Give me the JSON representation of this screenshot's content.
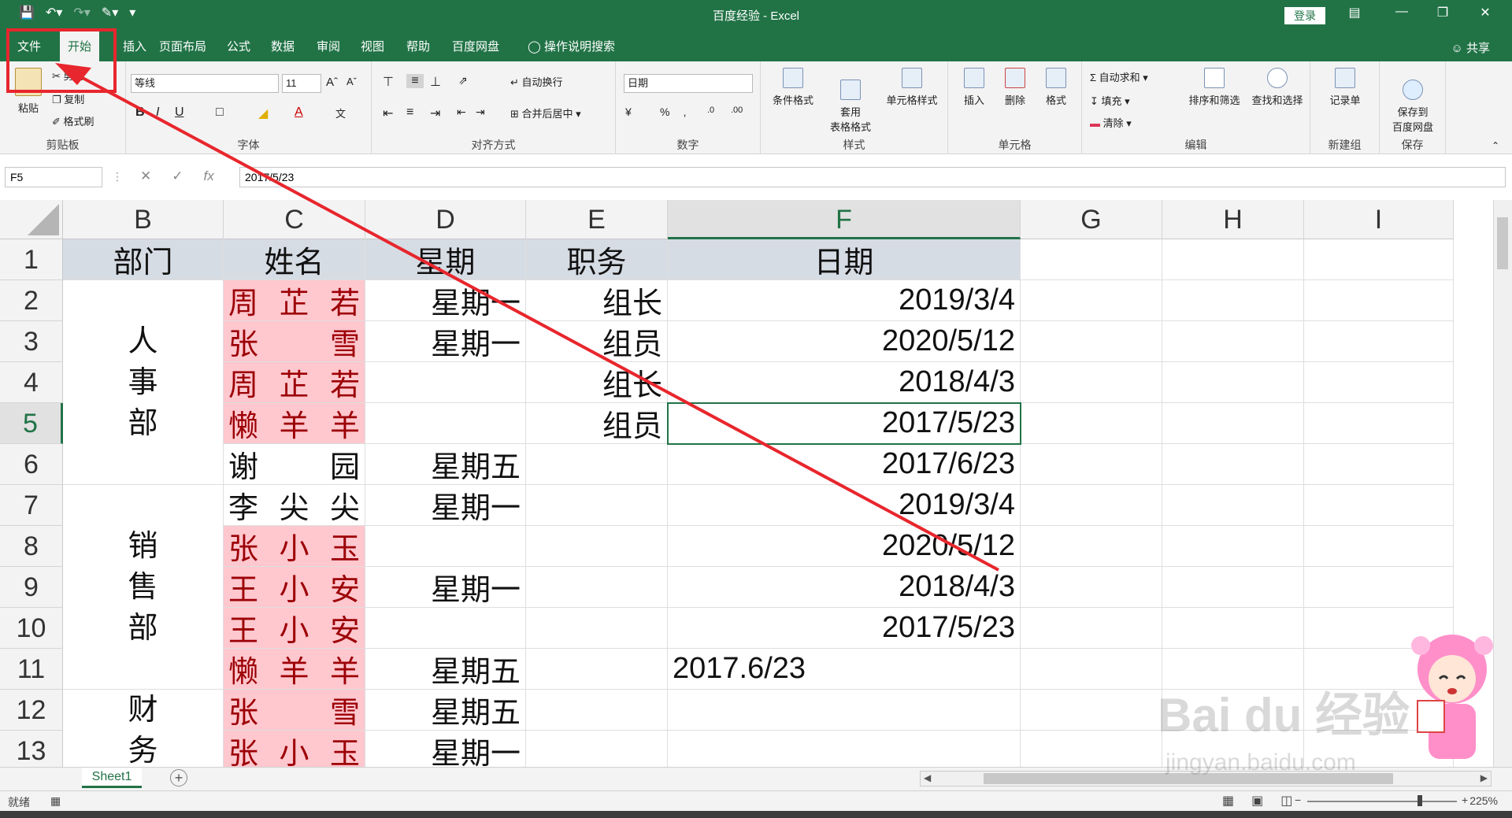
{
  "window": {
    "title": "百度经验 - Excel",
    "login_label": "登录",
    "share_label": "共享"
  },
  "ribbon_tabs": [
    "文件",
    "开始",
    "插入",
    "页面布局",
    "公式",
    "数据",
    "审阅",
    "视图",
    "帮助",
    "百度网盘",
    "操作说明搜索"
  ],
  "active_tab": "开始",
  "ribbon": {
    "clipboard": {
      "label": "剪贴板",
      "paste": "粘贴",
      "cut": "剪切",
      "copy": "复制",
      "format_painter": "格式刷"
    },
    "font": {
      "label": "字体",
      "font_name": "等线",
      "font_size": "11",
      "bold": "B",
      "italic": "I",
      "underline": "U"
    },
    "alignment": {
      "label": "对齐方式",
      "wrap_text": "自动换行",
      "merge_center": "合并后居中"
    },
    "number": {
      "label": "数字",
      "format": "日期",
      "percent": "%"
    },
    "styles": {
      "label": "样式",
      "conditional": "条件格式",
      "table_format": "套用\n表格格式",
      "cell_styles": "单元格样式"
    },
    "cells": {
      "label": "单元格",
      "insert": "插入",
      "delete": "删除",
      "format": "格式"
    },
    "editing": {
      "label": "编辑",
      "autosum": "自动求和",
      "fill": "填充",
      "clear": "清除",
      "sort_filter": "排序和筛选",
      "find_select": "查找和选择"
    },
    "new_group": {
      "label": "新建组",
      "record": "记录单"
    },
    "save": {
      "label": "保存",
      "save_to": "保存到\n百度网盘"
    }
  },
  "formula_bar": {
    "name_box": "F5",
    "value": "2017/5/23",
    "fx": "fx"
  },
  "columns": [
    "B",
    "C",
    "D",
    "E",
    "F",
    "G",
    "H",
    "I"
  ],
  "selected_column": "F",
  "rows": [
    "1",
    "2",
    "3",
    "4",
    "5",
    "6",
    "7",
    "8",
    "9",
    "10",
    "11",
    "12",
    "13"
  ],
  "selected_row": "5",
  "sheet": {
    "header": {
      "B": "部门",
      "C": "姓名",
      "D": "星期",
      "E": "职务",
      "F": "日期"
    },
    "dept_groups": [
      {
        "chars": [
          "人",
          "事",
          "部"
        ]
      },
      {
        "chars": [
          "销",
          "售",
          "部"
        ]
      },
      {
        "chars": [
          "财",
          "务"
        ]
      }
    ],
    "names": [
      [
        "周",
        "芷",
        "若"
      ],
      [
        "张",
        "",
        "雪"
      ],
      [
        "周",
        "芷",
        "若"
      ],
      [
        "懒",
        "羊",
        "羊"
      ],
      [
        "谢",
        "",
        "园"
      ],
      [
        "李",
        "尖",
        "尖"
      ],
      [
        "张",
        "小",
        "玉"
      ],
      [
        "王",
        "小",
        "安"
      ],
      [
        "王",
        "小",
        "安"
      ],
      [
        "懒",
        "羊",
        "羊"
      ],
      [
        "张",
        "",
        "雪"
      ],
      [
        "张",
        "小",
        "玉"
      ]
    ],
    "weekday": [
      "星期一",
      "星期一",
      "",
      "",
      "星期五",
      "星期一",
      "",
      "星期一",
      "",
      "星期五",
      "星期五",
      "星期一"
    ],
    "title": [
      "组长",
      "组员",
      "组长",
      "组员",
      "",
      "",
      "",
      "",
      "",
      "",
      "",
      ""
    ],
    "date": [
      "2019/3/4",
      "2020/5/12",
      "2018/4/3",
      "2017/5/23",
      "2017/6/23",
      "2019/3/4",
      "2020/5/12",
      "2018/4/3",
      "2017/5/23",
      "2017.6/23",
      "",
      ""
    ],
    "date_is_text": [
      false,
      false,
      false,
      false,
      false,
      false,
      false,
      false,
      false,
      true,
      false,
      false
    ],
    "pink_rows": [
      true,
      true,
      true,
      true,
      false,
      false,
      true,
      true,
      true,
      true,
      true,
      true
    ]
  },
  "sheet_tab": "Sheet1",
  "status": {
    "ready": "就绪",
    "zoom": "225%"
  },
  "watermark": {
    "main": "Bai du 经验",
    "sub": "jingyan.baidu.com"
  },
  "colors": {
    "excel_green": "#217346",
    "pink_fill": "#ffc7ce",
    "pink_text": "#9c0006",
    "header_fill": "#d6dce4",
    "annotation_red": "#e8262d"
  }
}
